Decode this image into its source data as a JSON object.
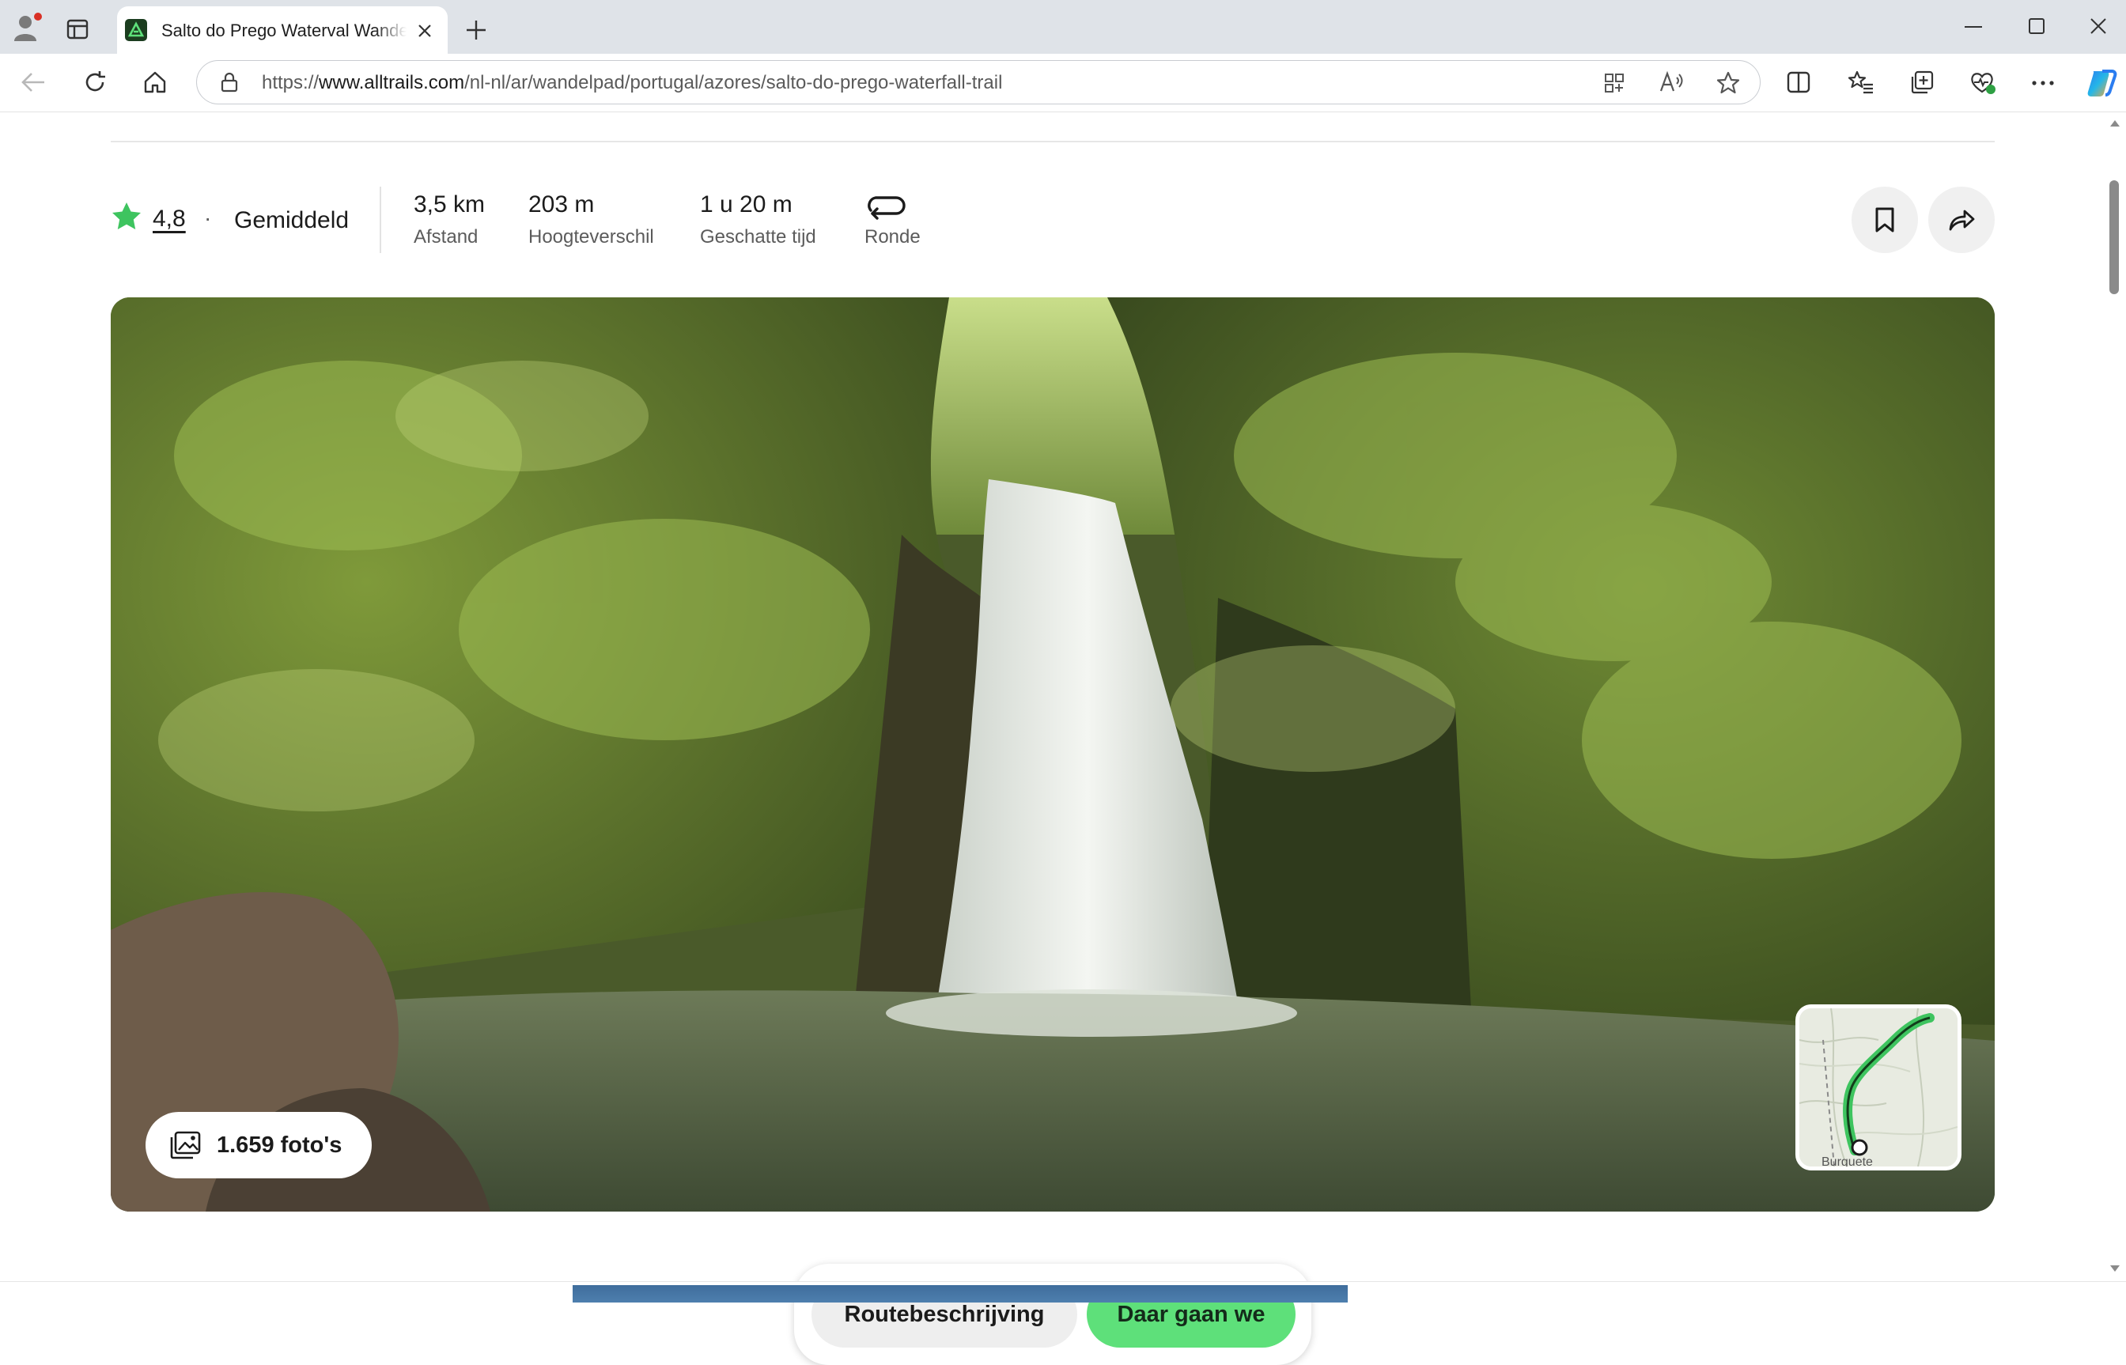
{
  "browser": {
    "tab_title": "Salto do Prego Waterval Wandelroute",
    "url_protocol": "https://",
    "url_host": "www.alltrails.com",
    "url_path": "/nl-nl/ar/wandelpad/portugal/azores/salto-do-prego-waterfall-trail",
    "icons": [
      "profile-icon",
      "tab-actions-icon",
      "close-tab-icon",
      "new-tab-icon",
      "minimize-icon",
      "maximize-icon",
      "close-window-icon",
      "back-icon",
      "refresh-icon",
      "home-icon",
      "lock-icon",
      "apps-icon",
      "read-aloud-icon",
      "favorite-star-icon",
      "split-screen-icon",
      "favorites-icon",
      "collections-icon",
      "browser-essentials-icon",
      "more-icon",
      "copilot-icon"
    ]
  },
  "trail": {
    "rating": "4,8",
    "separator": "·",
    "difficulty": "Gemiddeld",
    "stats": [
      {
        "value": "3,5 km",
        "label": "Afstand"
      },
      {
        "value": "203 m",
        "label": "Hoogteverschil"
      },
      {
        "value": "1 u 20 m",
        "label": "Geschatte tijd"
      }
    ],
    "route_type_label": "Ronde"
  },
  "hero": {
    "photos_label": "1.659 foto's",
    "map_place_label": "Burguete"
  },
  "cta": {
    "directions_label": "Routebeschrijving",
    "go_label": "Daar gaan we"
  },
  "colors": {
    "accent_green": "#5ee07a",
    "star_green": "#3ec45f"
  }
}
